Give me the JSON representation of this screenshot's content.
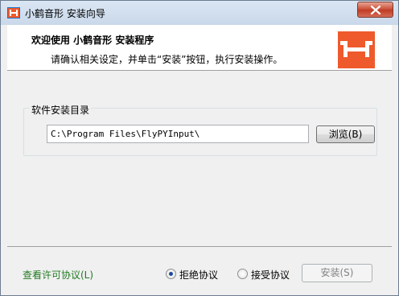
{
  "window": {
    "title": "小鹤音形 安装向导"
  },
  "header": {
    "title": "欢迎使用 小鹤音形 安装程序",
    "subtitle": "请确认相关设定，并单击“安装”按钮，执行安装操作。"
  },
  "install_dir": {
    "group_label": "软件安装目录",
    "path_value": "C:\\Program Files\\FlyPYInput\\",
    "browse_label": "浏览(B)"
  },
  "footer": {
    "license_link": "查看许可协议(L)",
    "radio_reject_label": "拒绝协议",
    "radio_accept_label": "接受协议",
    "selected_option": "拒绝协议",
    "install_label": "安装(S)",
    "install_enabled": false
  },
  "colors": {
    "logo_bg": "#ee5a2c",
    "link_green": "#227a22",
    "close_red": "#c84a33"
  },
  "icons": [
    "app-icon",
    "close-icon",
    "logo-icon"
  ]
}
